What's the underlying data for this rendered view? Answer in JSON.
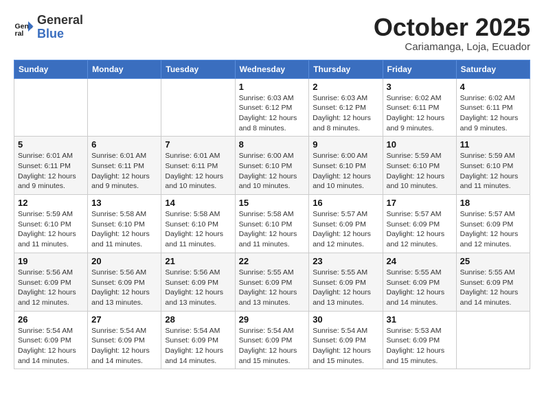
{
  "logo": {
    "text1": "General",
    "text2": "Blue"
  },
  "title": "October 2025",
  "subtitle": "Cariamanga, Loja, Ecuador",
  "weekdays": [
    "Sunday",
    "Monday",
    "Tuesday",
    "Wednesday",
    "Thursday",
    "Friday",
    "Saturday"
  ],
  "weeks": [
    [
      {
        "day": "",
        "info": ""
      },
      {
        "day": "",
        "info": ""
      },
      {
        "day": "",
        "info": ""
      },
      {
        "day": "1",
        "info": "Sunrise: 6:03 AM\nSunset: 6:12 PM\nDaylight: 12 hours\nand 8 minutes."
      },
      {
        "day": "2",
        "info": "Sunrise: 6:03 AM\nSunset: 6:12 PM\nDaylight: 12 hours\nand 8 minutes."
      },
      {
        "day": "3",
        "info": "Sunrise: 6:02 AM\nSunset: 6:11 PM\nDaylight: 12 hours\nand 9 minutes."
      },
      {
        "day": "4",
        "info": "Sunrise: 6:02 AM\nSunset: 6:11 PM\nDaylight: 12 hours\nand 9 minutes."
      }
    ],
    [
      {
        "day": "5",
        "info": "Sunrise: 6:01 AM\nSunset: 6:11 PM\nDaylight: 12 hours\nand 9 minutes."
      },
      {
        "day": "6",
        "info": "Sunrise: 6:01 AM\nSunset: 6:11 PM\nDaylight: 12 hours\nand 9 minutes."
      },
      {
        "day": "7",
        "info": "Sunrise: 6:01 AM\nSunset: 6:11 PM\nDaylight: 12 hours\nand 10 minutes."
      },
      {
        "day": "8",
        "info": "Sunrise: 6:00 AM\nSunset: 6:10 PM\nDaylight: 12 hours\nand 10 minutes."
      },
      {
        "day": "9",
        "info": "Sunrise: 6:00 AM\nSunset: 6:10 PM\nDaylight: 12 hours\nand 10 minutes."
      },
      {
        "day": "10",
        "info": "Sunrise: 5:59 AM\nSunset: 6:10 PM\nDaylight: 12 hours\nand 10 minutes."
      },
      {
        "day": "11",
        "info": "Sunrise: 5:59 AM\nSunset: 6:10 PM\nDaylight: 12 hours\nand 11 minutes."
      }
    ],
    [
      {
        "day": "12",
        "info": "Sunrise: 5:59 AM\nSunset: 6:10 PM\nDaylight: 12 hours\nand 11 minutes."
      },
      {
        "day": "13",
        "info": "Sunrise: 5:58 AM\nSunset: 6:10 PM\nDaylight: 12 hours\nand 11 minutes."
      },
      {
        "day": "14",
        "info": "Sunrise: 5:58 AM\nSunset: 6:10 PM\nDaylight: 12 hours\nand 11 minutes."
      },
      {
        "day": "15",
        "info": "Sunrise: 5:58 AM\nSunset: 6:10 PM\nDaylight: 12 hours\nand 11 minutes."
      },
      {
        "day": "16",
        "info": "Sunrise: 5:57 AM\nSunset: 6:09 PM\nDaylight: 12 hours\nand 12 minutes."
      },
      {
        "day": "17",
        "info": "Sunrise: 5:57 AM\nSunset: 6:09 PM\nDaylight: 12 hours\nand 12 minutes."
      },
      {
        "day": "18",
        "info": "Sunrise: 5:57 AM\nSunset: 6:09 PM\nDaylight: 12 hours\nand 12 minutes."
      }
    ],
    [
      {
        "day": "19",
        "info": "Sunrise: 5:56 AM\nSunset: 6:09 PM\nDaylight: 12 hours\nand 12 minutes."
      },
      {
        "day": "20",
        "info": "Sunrise: 5:56 AM\nSunset: 6:09 PM\nDaylight: 12 hours\nand 13 minutes."
      },
      {
        "day": "21",
        "info": "Sunrise: 5:56 AM\nSunset: 6:09 PM\nDaylight: 12 hours\nand 13 minutes."
      },
      {
        "day": "22",
        "info": "Sunrise: 5:55 AM\nSunset: 6:09 PM\nDaylight: 12 hours\nand 13 minutes."
      },
      {
        "day": "23",
        "info": "Sunrise: 5:55 AM\nSunset: 6:09 PM\nDaylight: 12 hours\nand 13 minutes."
      },
      {
        "day": "24",
        "info": "Sunrise: 5:55 AM\nSunset: 6:09 PM\nDaylight: 12 hours\nand 14 minutes."
      },
      {
        "day": "25",
        "info": "Sunrise: 5:55 AM\nSunset: 6:09 PM\nDaylight: 12 hours\nand 14 minutes."
      }
    ],
    [
      {
        "day": "26",
        "info": "Sunrise: 5:54 AM\nSunset: 6:09 PM\nDaylight: 12 hours\nand 14 minutes."
      },
      {
        "day": "27",
        "info": "Sunrise: 5:54 AM\nSunset: 6:09 PM\nDaylight: 12 hours\nand 14 minutes."
      },
      {
        "day": "28",
        "info": "Sunrise: 5:54 AM\nSunset: 6:09 PM\nDaylight: 12 hours\nand 14 minutes."
      },
      {
        "day": "29",
        "info": "Sunrise: 5:54 AM\nSunset: 6:09 PM\nDaylight: 12 hours\nand 15 minutes."
      },
      {
        "day": "30",
        "info": "Sunrise: 5:54 AM\nSunset: 6:09 PM\nDaylight: 12 hours\nand 15 minutes."
      },
      {
        "day": "31",
        "info": "Sunrise: 5:53 AM\nSunset: 6:09 PM\nDaylight: 12 hours\nand 15 minutes."
      },
      {
        "day": "",
        "info": ""
      }
    ]
  ]
}
